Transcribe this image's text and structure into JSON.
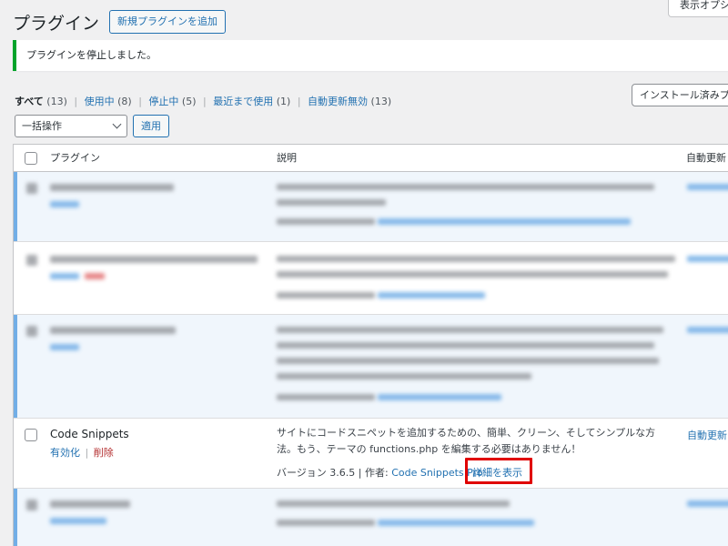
{
  "header": {
    "title": "プラグイン",
    "add_new_label": "新規プラグインを追加",
    "screen_options_label": "表示オプション"
  },
  "notice": {
    "text": "プラグインを停止しました。"
  },
  "filters": [
    {
      "label": "すべて",
      "count": "(13)"
    },
    {
      "label": "使用中",
      "count": "(8)"
    },
    {
      "label": "停止中",
      "count": "(5)"
    },
    {
      "label": "最近まで使用",
      "count": "(1)"
    },
    {
      "label": "自動更新無効",
      "count": "(13)"
    }
  ],
  "filter_separator": "|",
  "search": {
    "placeholder": "インストール済みプラグインを検索..."
  },
  "bulk": {
    "selected": "一括操作",
    "apply_label": "適用"
  },
  "table": {
    "col_plugin": "プラグイン",
    "col_desc": "説明",
    "col_auto": "自動更新"
  },
  "code_snippets": {
    "name": "Code Snippets",
    "activate_label": "有効化",
    "sep": "|",
    "delete_label": "削除",
    "desc_line1": "サイトにコードスニペットを追加するための、簡単、クリーン、そしてシンプルな方",
    "desc_line2": "法。もう、テーマの functions.php を編集する必要はありません！",
    "version_text": "バージョン 3.6.5 |",
    "author_prefix": "作者:",
    "author_link": "Code Snippets Pro",
    "details_link": "詳細を表示",
    "auto_update_link": "自動更新を有効化"
  },
  "colors": {
    "accent": "#2271b1",
    "notice_border": "#00a32a",
    "active_stripe": "#72aee6",
    "highlight": "#e00000",
    "delete": "#b32d2e"
  }
}
